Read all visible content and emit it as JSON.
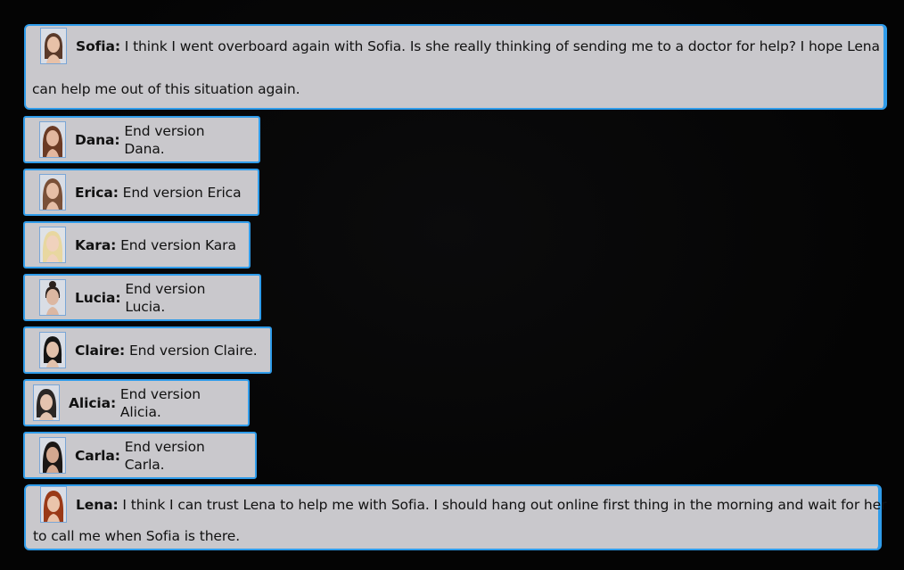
{
  "messages": [
    {
      "speaker": "Sofia:",
      "text_line1": " I think I went overboard again with Sofia. Is she really thinking of sending me to a doctor for help? I hope Lena",
      "text_line2": "can help me out of this situation again.",
      "avatar_hair": "#5a3a2a",
      "avatar_skin": "#e8c1a8"
    },
    {
      "speaker": "Dana:",
      "text": "End version Dana.",
      "avatar_hair": "#6b3a24",
      "avatar_skin": "#e3b79f"
    },
    {
      "speaker": "Erica:",
      "text": "End version Erica",
      "avatar_hair": "#7a5038",
      "avatar_skin": "#e6bea6"
    },
    {
      "speaker": "Kara:",
      "text": "End version Kara",
      "avatar_hair": "#e8d7a0",
      "avatar_skin": "#f0d2bd"
    },
    {
      "speaker": "Lucia:",
      "text": "End version Lucia.",
      "avatar_hair": "#2b211d",
      "avatar_skin": "#dcb7a2"
    },
    {
      "speaker": "Claire:",
      "text": "End version Claire.",
      "avatar_hair": "#161514",
      "avatar_skin": "#e2c1ab"
    },
    {
      "speaker": "Alicia:",
      "text": "End version Alicia.",
      "avatar_hair": "#2a2624",
      "avatar_skin": "#e4c3ae"
    },
    {
      "speaker": "Carla:",
      "text": "End version Carla.",
      "avatar_hair": "#1b1715",
      "avatar_skin": "#d4a88f"
    },
    {
      "speaker": "Lena:",
      "text_line1": "I think I can trust Lena to help me with Sofia. I should hang out online first thing in the morning and wait for her",
      "text_line2": "to call me when Sofia is there.",
      "avatar_hair": "#9a3a18",
      "avatar_skin": "#eac4ab"
    }
  ],
  "colors": {
    "background": "#050505",
    "bubble": "#c9c8cc",
    "border": "#2f9cea"
  }
}
